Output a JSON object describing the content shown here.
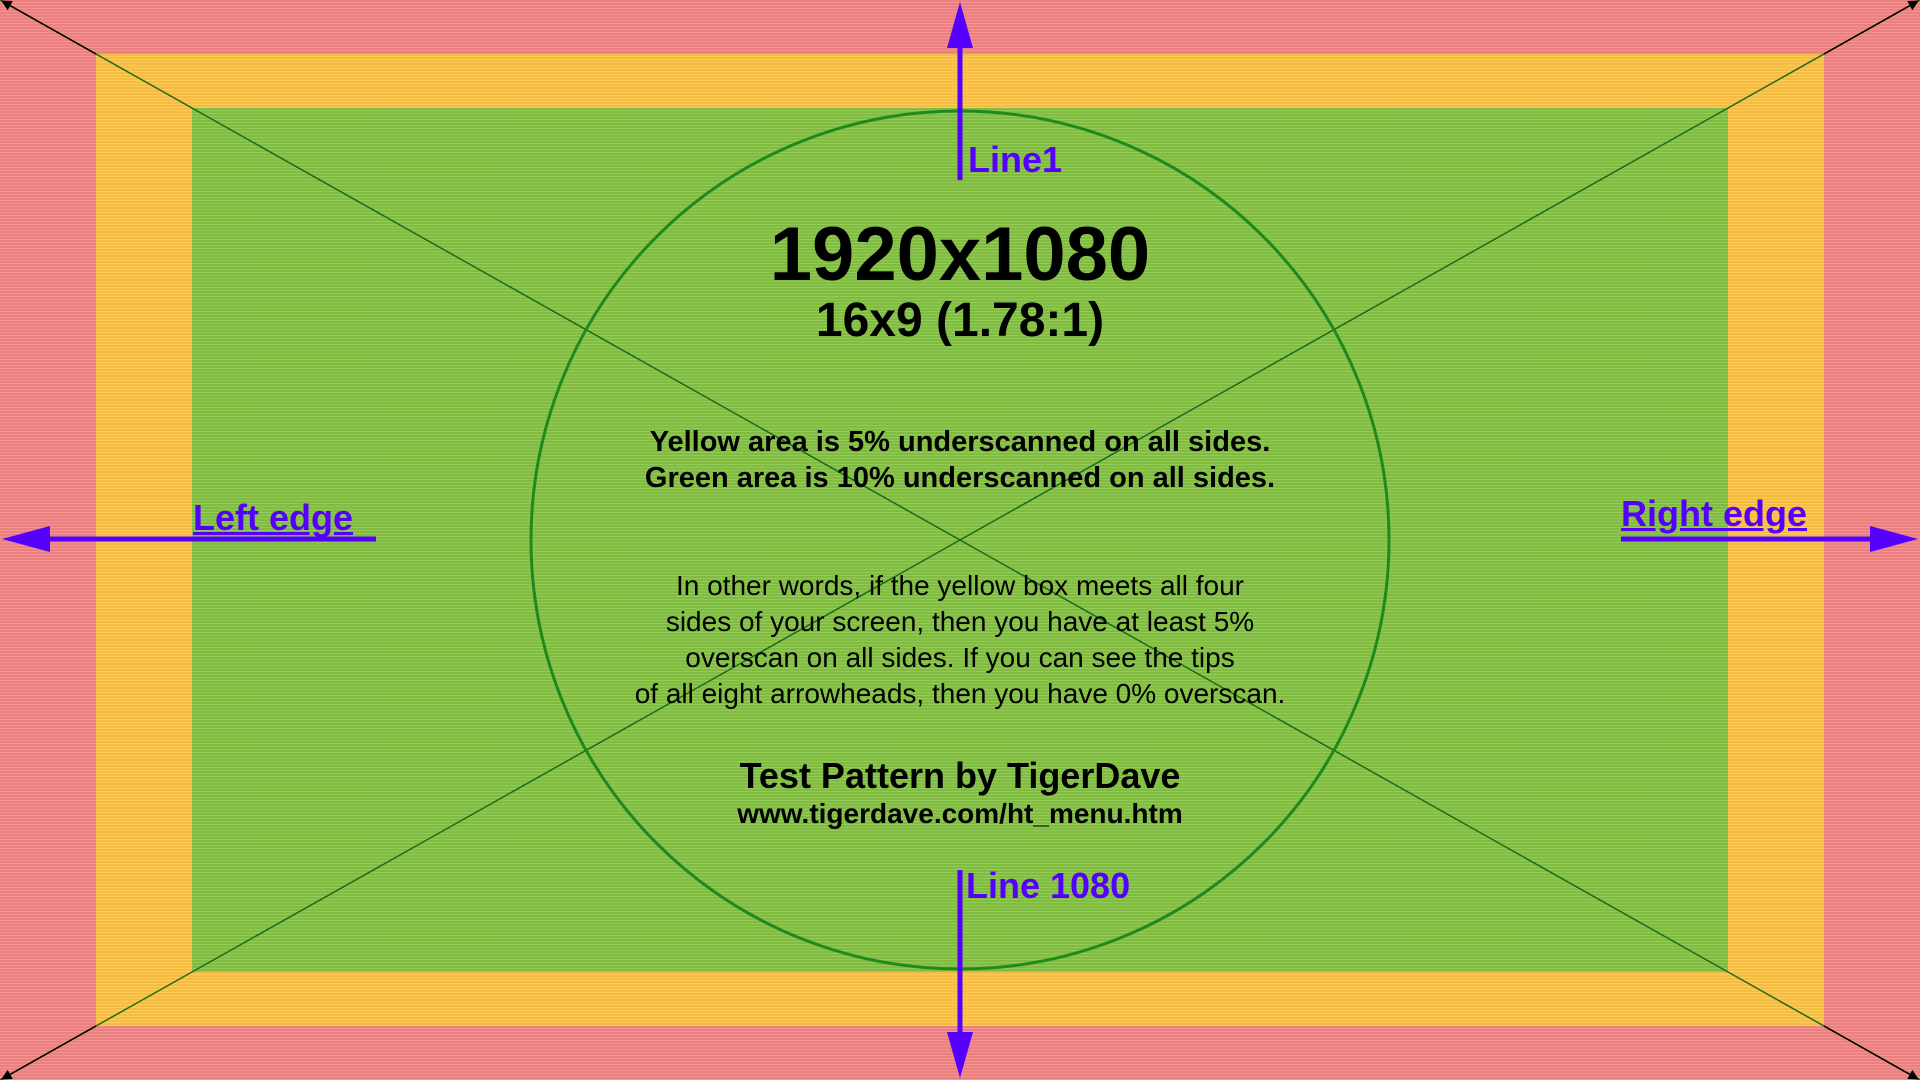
{
  "pattern": {
    "resolution": "1920x1080",
    "aspect": "16x9 (1.78:1)",
    "underscan_lines": [
      "Yellow area is 5% underscanned on all sides.",
      "Green area is 10% underscanned on all sides."
    ],
    "overscan_lines": [
      "In other words, if the yellow box meets all four",
      "sides of your screen, then you have at least 5%",
      "overscan on all sides. If you can see the tips",
      "of all eight arrowheads, then you have 0% overscan."
    ],
    "credit": "Test Pattern by TigerDave",
    "url": "www.tigerdave.com/ht_menu.htm"
  },
  "labels": {
    "line_top": "Line1",
    "line_bottom": "Line 1080",
    "left_edge": "Left edge",
    "right_edge": "Right edge"
  },
  "colors": {
    "red_zone": "#f48585",
    "yellow_zone": "#ffc445",
    "green_zone": "#86c444",
    "diagonal": "#1a6b1a",
    "circle": "#1e8a1e",
    "arrow": "#5500ff",
    "corner_arrow": "#000000"
  }
}
